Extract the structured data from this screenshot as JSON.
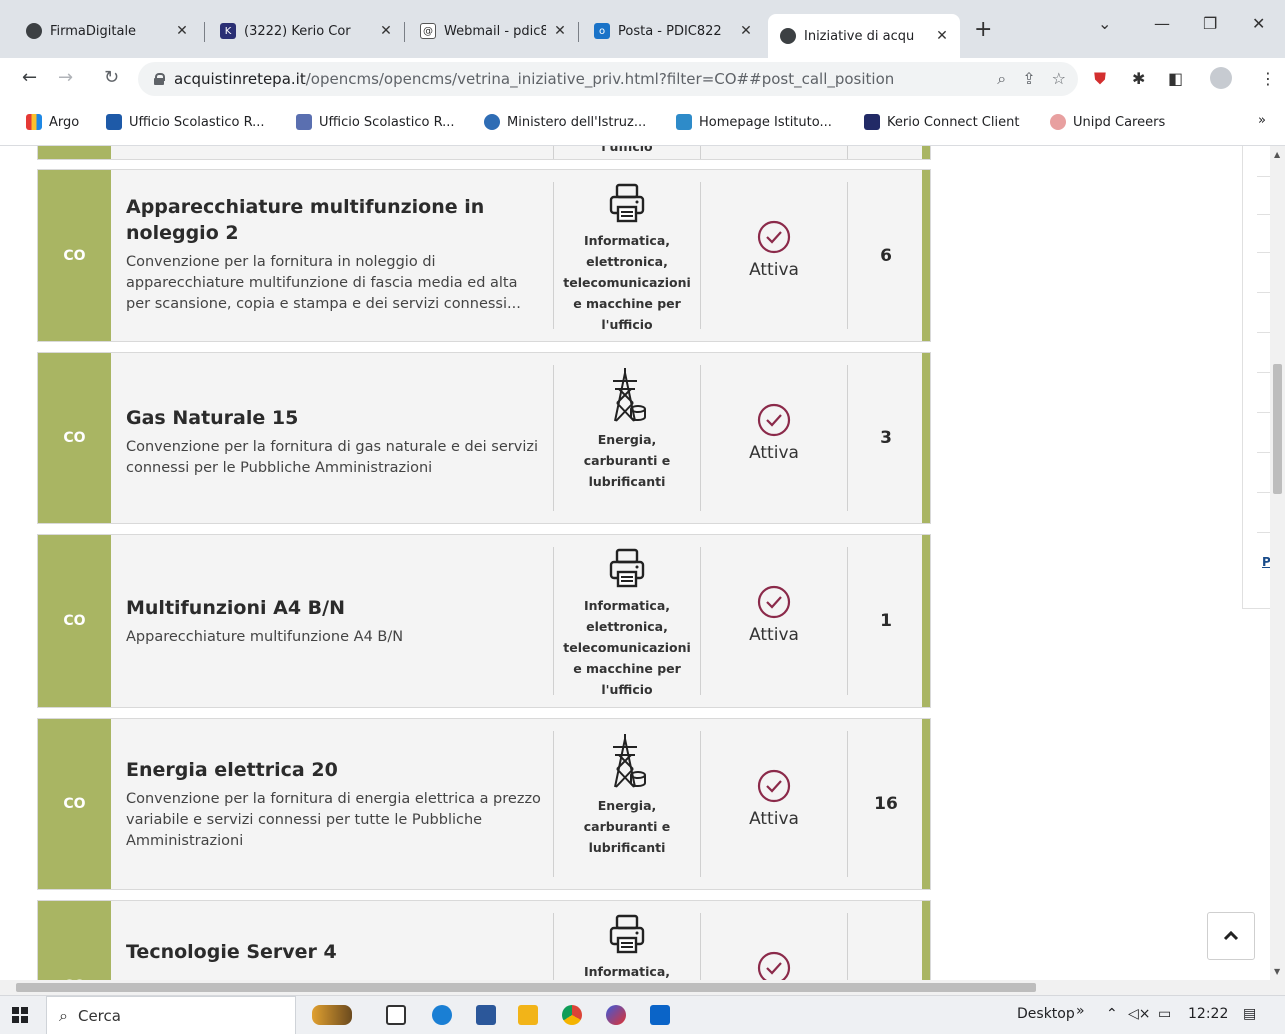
{
  "tabs": [
    {
      "title": "FirmaDigitale",
      "icon": "globe-icon"
    },
    {
      "title": "(3222) Kerio Cor",
      "icon": "kerio-icon"
    },
    {
      "title": "Webmail - pdic8",
      "icon": "webmail-icon"
    },
    {
      "title": "Posta - PDIC822",
      "icon": "outlook-icon"
    },
    {
      "title": "Iniziative di acqu",
      "icon": "globe-icon"
    }
  ],
  "url": {
    "host": "acquistinretepa.it",
    "path": "/opencms/opencms/vetrina_iniziative_priv.html?filter=CO##post_call_position"
  },
  "bookmarks": [
    {
      "label": "Argo",
      "color": "#e53935"
    },
    {
      "label": "Ufficio Scolastico R...",
      "color": "#1e5aa8"
    },
    {
      "label": "Ufficio Scolastico R...",
      "color": "#5a6fb0"
    },
    {
      "label": "Ministero dell'Istruz...",
      "color": "#2f6db5"
    },
    {
      "label": "Homepage Istituto...",
      "color": "#2e8bc9"
    },
    {
      "label": "Kerio Connect Client",
      "color": "#222a66"
    },
    {
      "label": "Unipd Careers",
      "color": "#e8a0a0"
    }
  ],
  "bookmarks_more": "»",
  "partial_row": {
    "category_tail": "l'ufficio"
  },
  "rows": [
    {
      "badge": "CO",
      "title": "Apparecchiature multifunzione in noleggio 2",
      "description": "Convenzione per la fornitura in noleggio di apparecchiature multifunzione di fascia media ed alta per scansione, copia e stampa e dei servizi connessi...",
      "category_icon": "printer-icon",
      "category": [
        "Informatica,",
        "elettronica,",
        "telecomunicazioni",
        "e macchine per",
        "l'ufficio"
      ],
      "status": "Attiva",
      "count": "6"
    },
    {
      "badge": "CO",
      "title": "Gas Naturale 15",
      "description": "Convenzione per la fornitura di gas naturale e dei servizi connessi per le Pubbliche Amministrazioni",
      "category_icon": "energy-pylon-icon",
      "category": [
        "Energia,",
        "carburanti e",
        "lubrificanti"
      ],
      "status": "Attiva",
      "count": "3"
    },
    {
      "badge": "CO",
      "title": "Multifunzioni A4 B/N",
      "description": "Apparecchiature multifunzione A4 B/N",
      "category_icon": "printer-icon",
      "category": [
        "Informatica,",
        "elettronica,",
        "telecomunicazioni",
        "e macchine per",
        "l'ufficio"
      ],
      "status": "Attiva",
      "count": "1"
    },
    {
      "badge": "CO",
      "title": "Energia elettrica 20",
      "description": "Convenzione per la fornitura di energia elettrica a prezzo variabile e servizi connessi per tutte le Pubbliche Amministrazioni",
      "category_icon": "energy-pylon-icon",
      "category": [
        "Energia,",
        "carburanti e",
        "lubrificanti"
      ],
      "status": "Attiva",
      "count": "16"
    },
    {
      "badge": "CO",
      "title": "Tecnologie Server 4",
      "description": "",
      "category_icon": "printer-icon",
      "category": [
        "Informatica,"
      ],
      "status": "",
      "count": ""
    }
  ],
  "side_link": "Pl",
  "taskbar": {
    "search_placeholder": "Cerca",
    "desktop_label": "Desktop",
    "time": "12:22"
  },
  "colors": {
    "accent_green": "#a9b563",
    "check_purple": "#8b2a4a"
  }
}
